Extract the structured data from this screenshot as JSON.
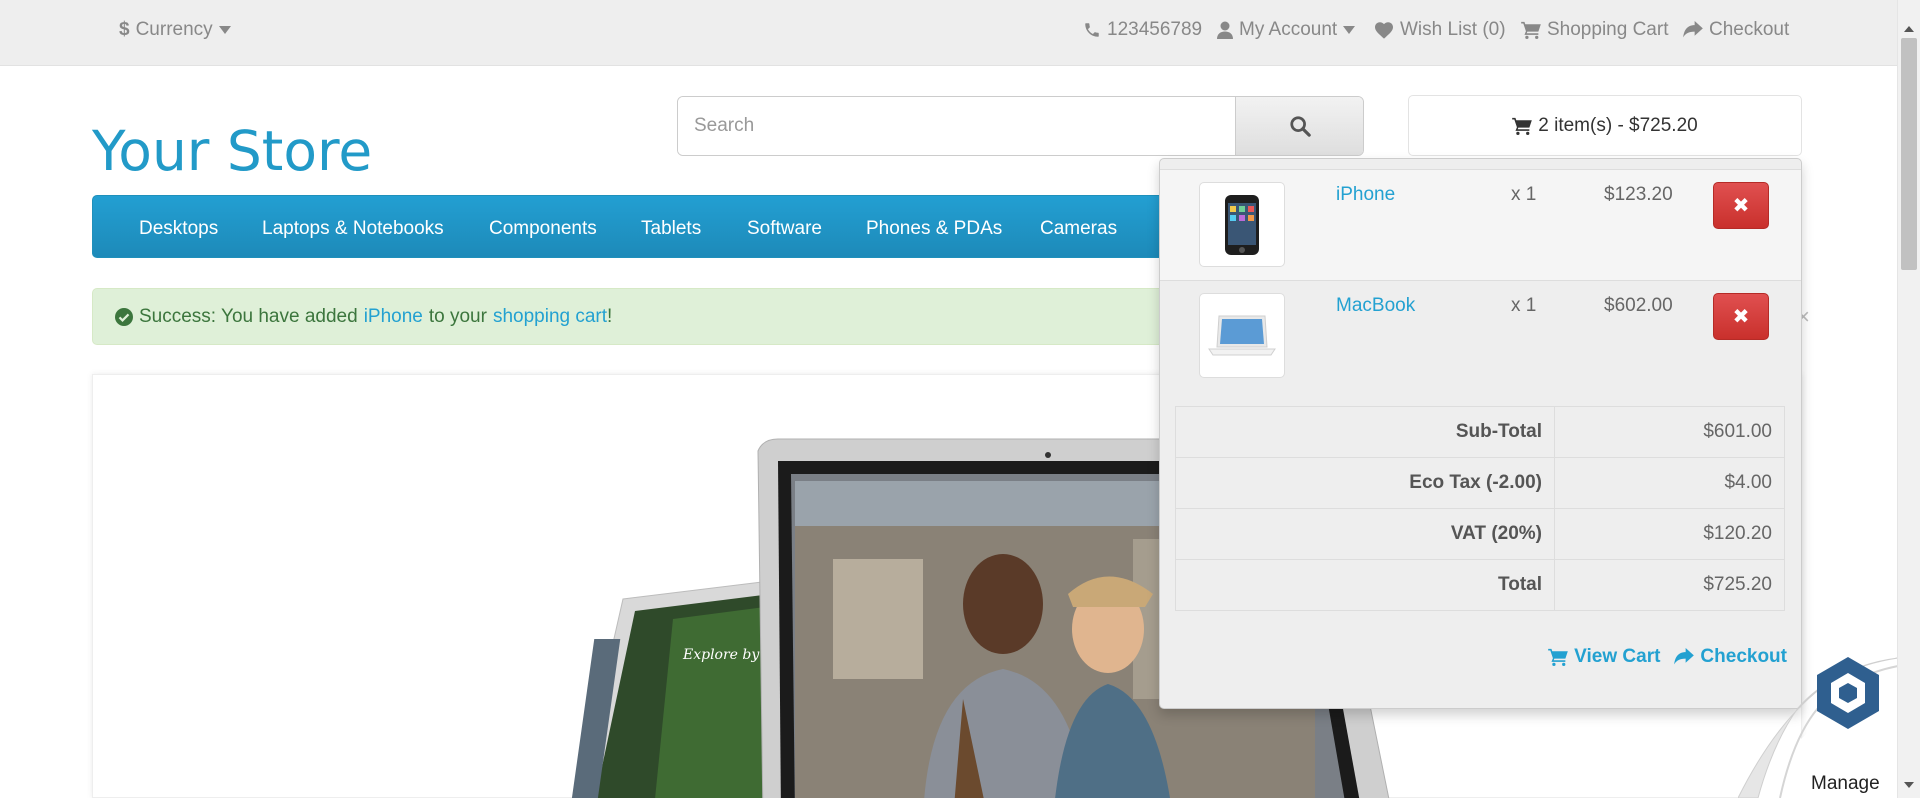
{
  "topbar": {
    "currency_label": "Currency",
    "phone": "123456789",
    "my_account": "My Account",
    "wishlist": "Wish List (0)",
    "shopping_cart": "Shopping Cart",
    "checkout": "Checkout"
  },
  "header": {
    "logo": "Your Store",
    "search_placeholder": "Search",
    "cart_button": "2 item(s) - $725.20"
  },
  "menu": {
    "items": [
      "Desktops",
      "Laptops & Notebooks",
      "Components",
      "Tablets",
      "Software",
      "Phones & PDAs",
      "Cameras"
    ]
  },
  "alert": {
    "prefix": "Success: You have added",
    "product_link": "iPhone",
    "middle": "to your",
    "cart_link": "shopping cart",
    "suffix": "!"
  },
  "cart_dropdown": {
    "products": [
      {
        "name": "iPhone",
        "qty": "x 1",
        "price": "$123.20"
      },
      {
        "name": "MacBook",
        "qty": "x 1",
        "price": "$602.00"
      }
    ],
    "totals": [
      {
        "label": "Sub-Total",
        "value": "$601.00"
      },
      {
        "label": "Eco Tax (-2.00)",
        "value": "$4.00"
      },
      {
        "label": "VAT (20%)",
        "value": "$120.20"
      },
      {
        "label": "Total",
        "value": "$725.20"
      }
    ],
    "view_cart": "View Cart",
    "checkout": "Checkout"
  },
  "manage_badge": {
    "label": "Manage"
  },
  "colors": {
    "brand": "#229ac8",
    "danger": "#c9302c",
    "success_bg": "#dff0d8"
  }
}
